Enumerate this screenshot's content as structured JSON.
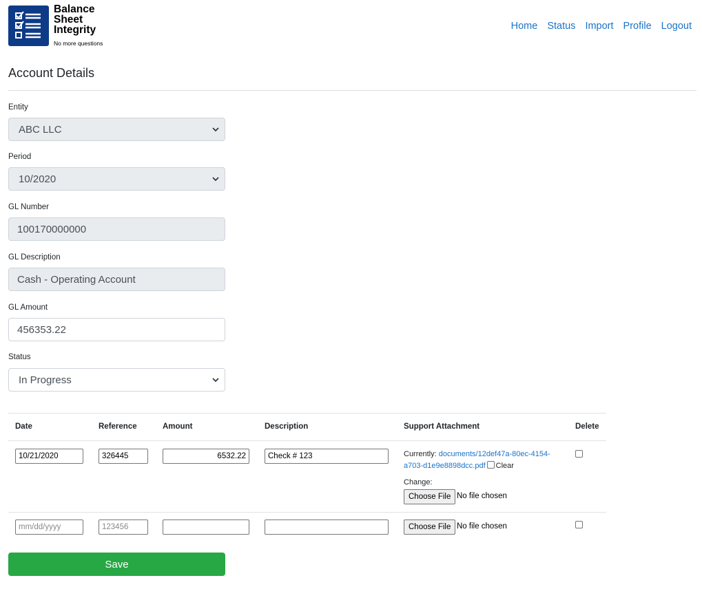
{
  "brand": {
    "title": "Balance\nSheet\nIntegrity",
    "tagline": "No more questions"
  },
  "nav": {
    "items": [
      "Home",
      "Status",
      "Import",
      "Profile",
      "Logout"
    ]
  },
  "page": {
    "title": "Account Details"
  },
  "form": {
    "entity": {
      "label": "Entity",
      "value": "ABC LLC"
    },
    "period": {
      "label": "Period",
      "value": "10/2020"
    },
    "gl_number": {
      "label": "GL Number",
      "value": "100170000000"
    },
    "gl_description": {
      "label": "GL Description",
      "value": "Cash - Operating Account"
    },
    "gl_amount": {
      "label": "GL Amount",
      "value": "456353.22"
    },
    "status": {
      "label": "Status",
      "value": "In Progress"
    }
  },
  "table": {
    "headers": [
      "Date",
      "Reference",
      "Amount",
      "Description",
      "Support Attachment",
      "Delete"
    ],
    "rows": [
      {
        "date": "10/21/2020",
        "reference": "326445",
        "amount": "6532.22",
        "description": "Check # 123",
        "currently_label": "Currently:",
        "attachment_link_line1": "documents/12def47a-80ec-4154-",
        "attachment_link_line2": "a703-d1e9e8898dcc.pdf",
        "clear_label": "Clear",
        "change_label": "Change:",
        "choose_file": "Choose File",
        "file_status": "No file chosen"
      },
      {
        "date_placeholder": "mm/dd/yyyy",
        "reference_placeholder": "123456",
        "amount": "",
        "description": "",
        "choose_file": "Choose File",
        "file_status": "No file chosen"
      }
    ]
  },
  "actions": {
    "save_label": "Save"
  },
  "colors": {
    "brand_blue": "#0d3b87",
    "link": "#1a73c8",
    "save_green": "#28a745",
    "readonly_bg": "#e9ecef"
  }
}
